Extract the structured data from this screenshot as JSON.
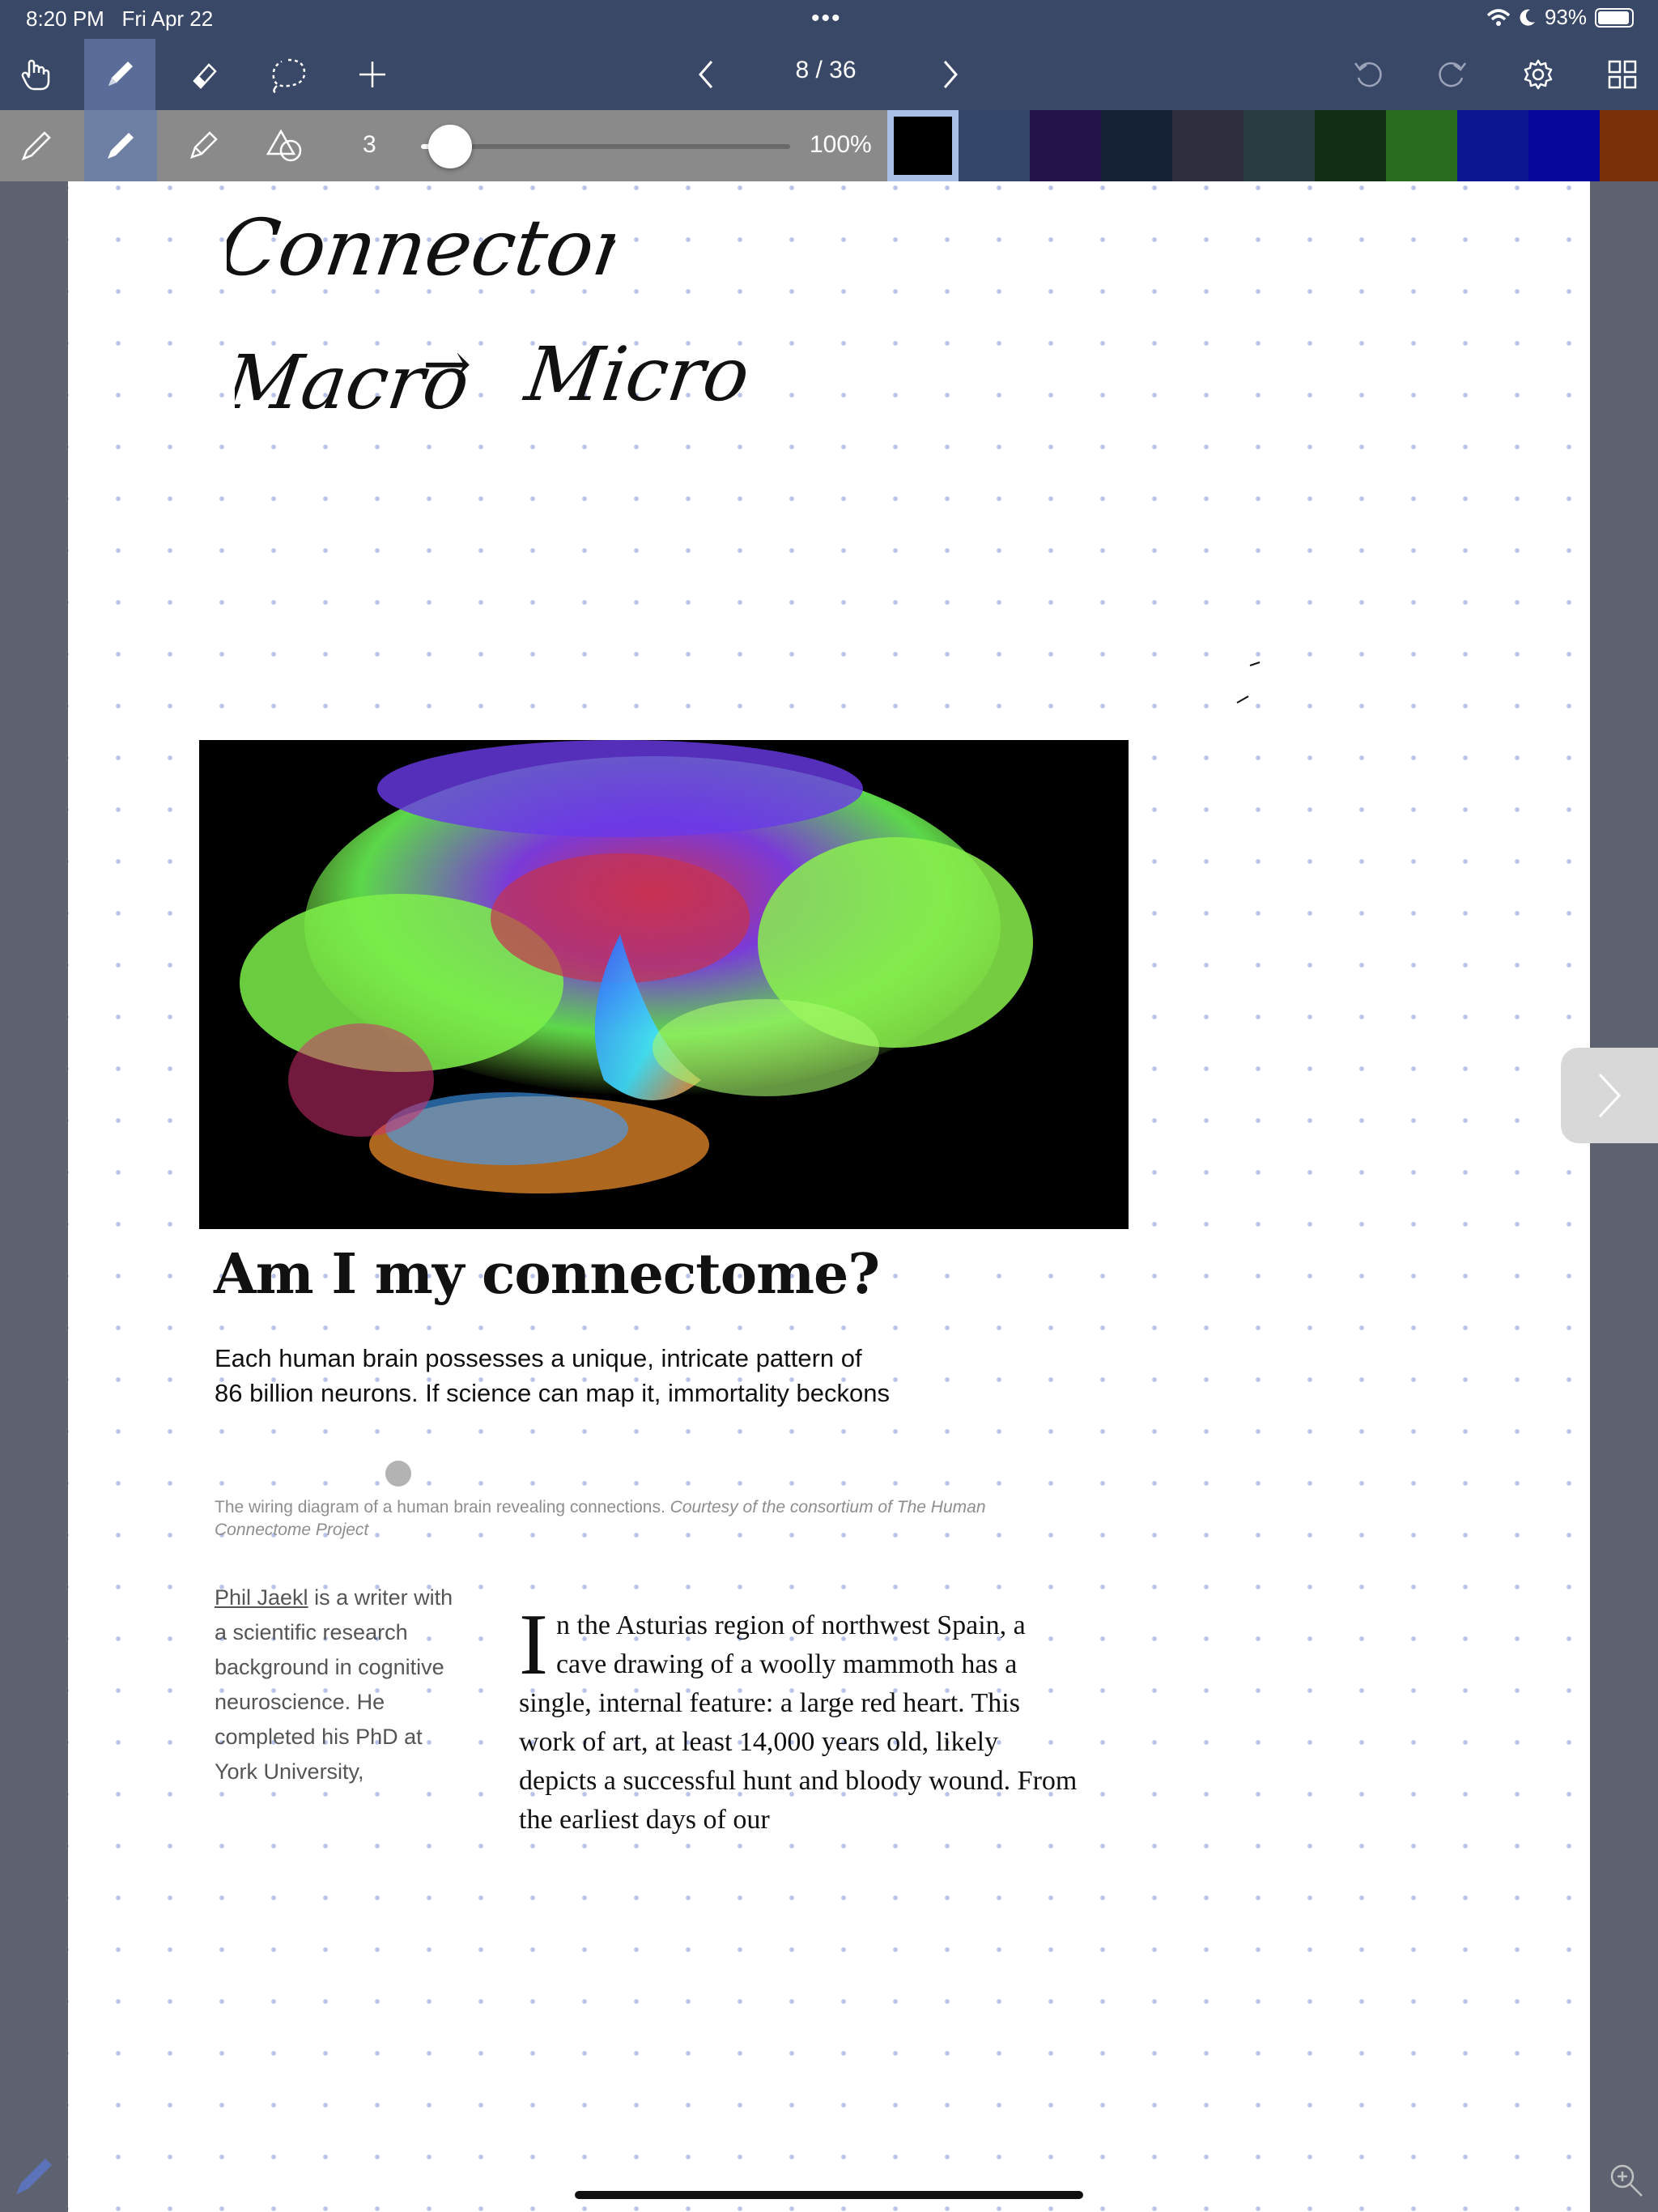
{
  "status": {
    "time": "8:20 PM",
    "date": "Fri Apr 22",
    "battery": "93%",
    "battery_level": 0.93
  },
  "toolbar": {
    "page_counter": "8 / 36",
    "left_tools": [
      "hand-icon",
      "pen-icon",
      "eraser-icon",
      "lasso-icon",
      "plus-icon"
    ],
    "active_tool": "pen-icon",
    "right_tools": [
      "undo-icon",
      "redo-icon",
      "gear-icon",
      "grid-icon"
    ]
  },
  "pen_options": {
    "size": "3",
    "size_slider_value": 0.08,
    "opacity": "100%",
    "pen_types": [
      "fountain-pen-icon",
      "ballpoint-pen-icon",
      "pencil-icon",
      "shape-icon"
    ],
    "active_pen_type": "ballpoint-pen-icon",
    "colors": [
      "#000000",
      "#34466a",
      "#24124a",
      "#142036",
      "#2e2e3e",
      "#2a3c40",
      "#0f2e14",
      "#266c1c",
      "#0c1690",
      "#05089a",
      "#7a3008"
    ],
    "selected_color": "#000000"
  },
  "notes": {
    "handwriting_1": "Connectome",
    "handwriting_2": "Macro",
    "handwriting_arrow": "→",
    "handwriting_3": "Micro"
  },
  "article": {
    "headline": "Am I my connectome?",
    "standfirst": "Each human brain possesses a unique, intricate pattern of 86 billion neurons. If science can map it, immortality beckons",
    "caption_main": "The wiring diagram of a human brain revealing connections.",
    "caption_credit": "Courtesy of the consortium of The Human Connectome Project",
    "author_name": "Phil Jaekl",
    "author_bio": " is a writer with a scientific research background in cognitive neuroscience. He completed his PhD at York University,",
    "body_dropcap": "I",
    "body_text": "n the Asturias region of northwest Spain, a cave drawing of a woolly mammoth has a single, internal feature: a large red heart. This work of art, at least 14,000 years old, likely depicts a successful hunt and bloody wound. From the earliest days of our"
  }
}
